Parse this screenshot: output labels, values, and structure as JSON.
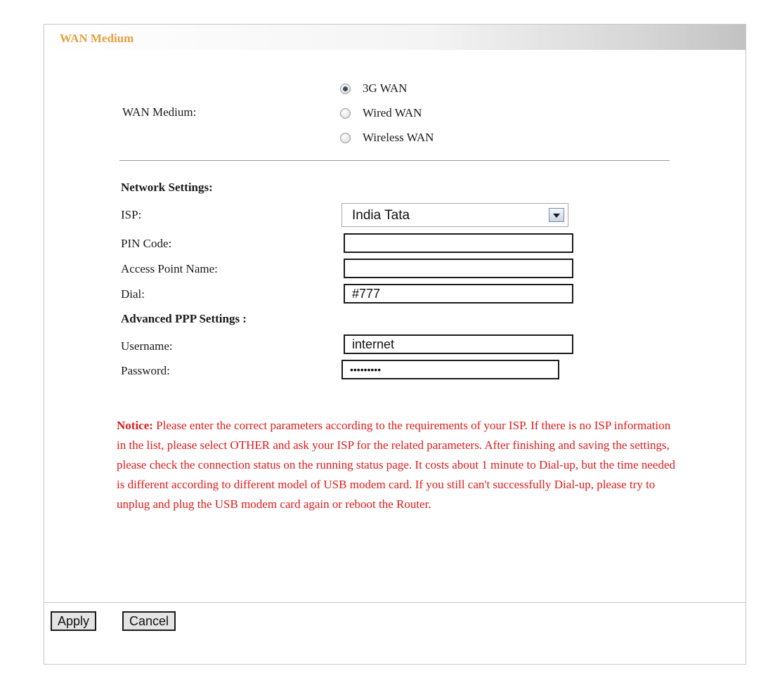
{
  "panel": {
    "title": "WAN Medium"
  },
  "wan_medium": {
    "label": "WAN Medium:",
    "options": [
      {
        "label": "3G WAN",
        "checked": true
      },
      {
        "label": "Wired WAN",
        "checked": false
      },
      {
        "label": "Wireless WAN",
        "checked": false
      }
    ]
  },
  "network": {
    "heading": "Network Settings:",
    "isp_label": "ISP:",
    "isp_value": "India Tata",
    "pin_label": "PIN Code:",
    "pin_value": "",
    "apn_label": "Access Point Name:",
    "apn_value": "",
    "dial_label": "Dial:",
    "dial_value": "#777"
  },
  "ppp": {
    "heading": "Advanced PPP Settings :",
    "username_label": "Username:",
    "username_value": "internet",
    "password_label": "Password:",
    "password_value": "•••••••••"
  },
  "notice": {
    "label": "Notice:",
    "text": " Please enter the correct parameters according to the requirements of your ISP. If there is no ISP information in the list, please select OTHER and ask your ISP for the related parameters. After finishing and saving the settings, please check the connection status on the running status page. It costs about 1 minute to Dial-up, but the time needed is different according to different model of USB modem card. If you still can't successfully Dial-up, please try to unplug and plug the USB modem card again or reboot the Router."
  },
  "buttons": {
    "apply": "Apply",
    "cancel": "Cancel"
  },
  "colors": {
    "title": "#e8a040",
    "notice": "#e21a1a"
  }
}
